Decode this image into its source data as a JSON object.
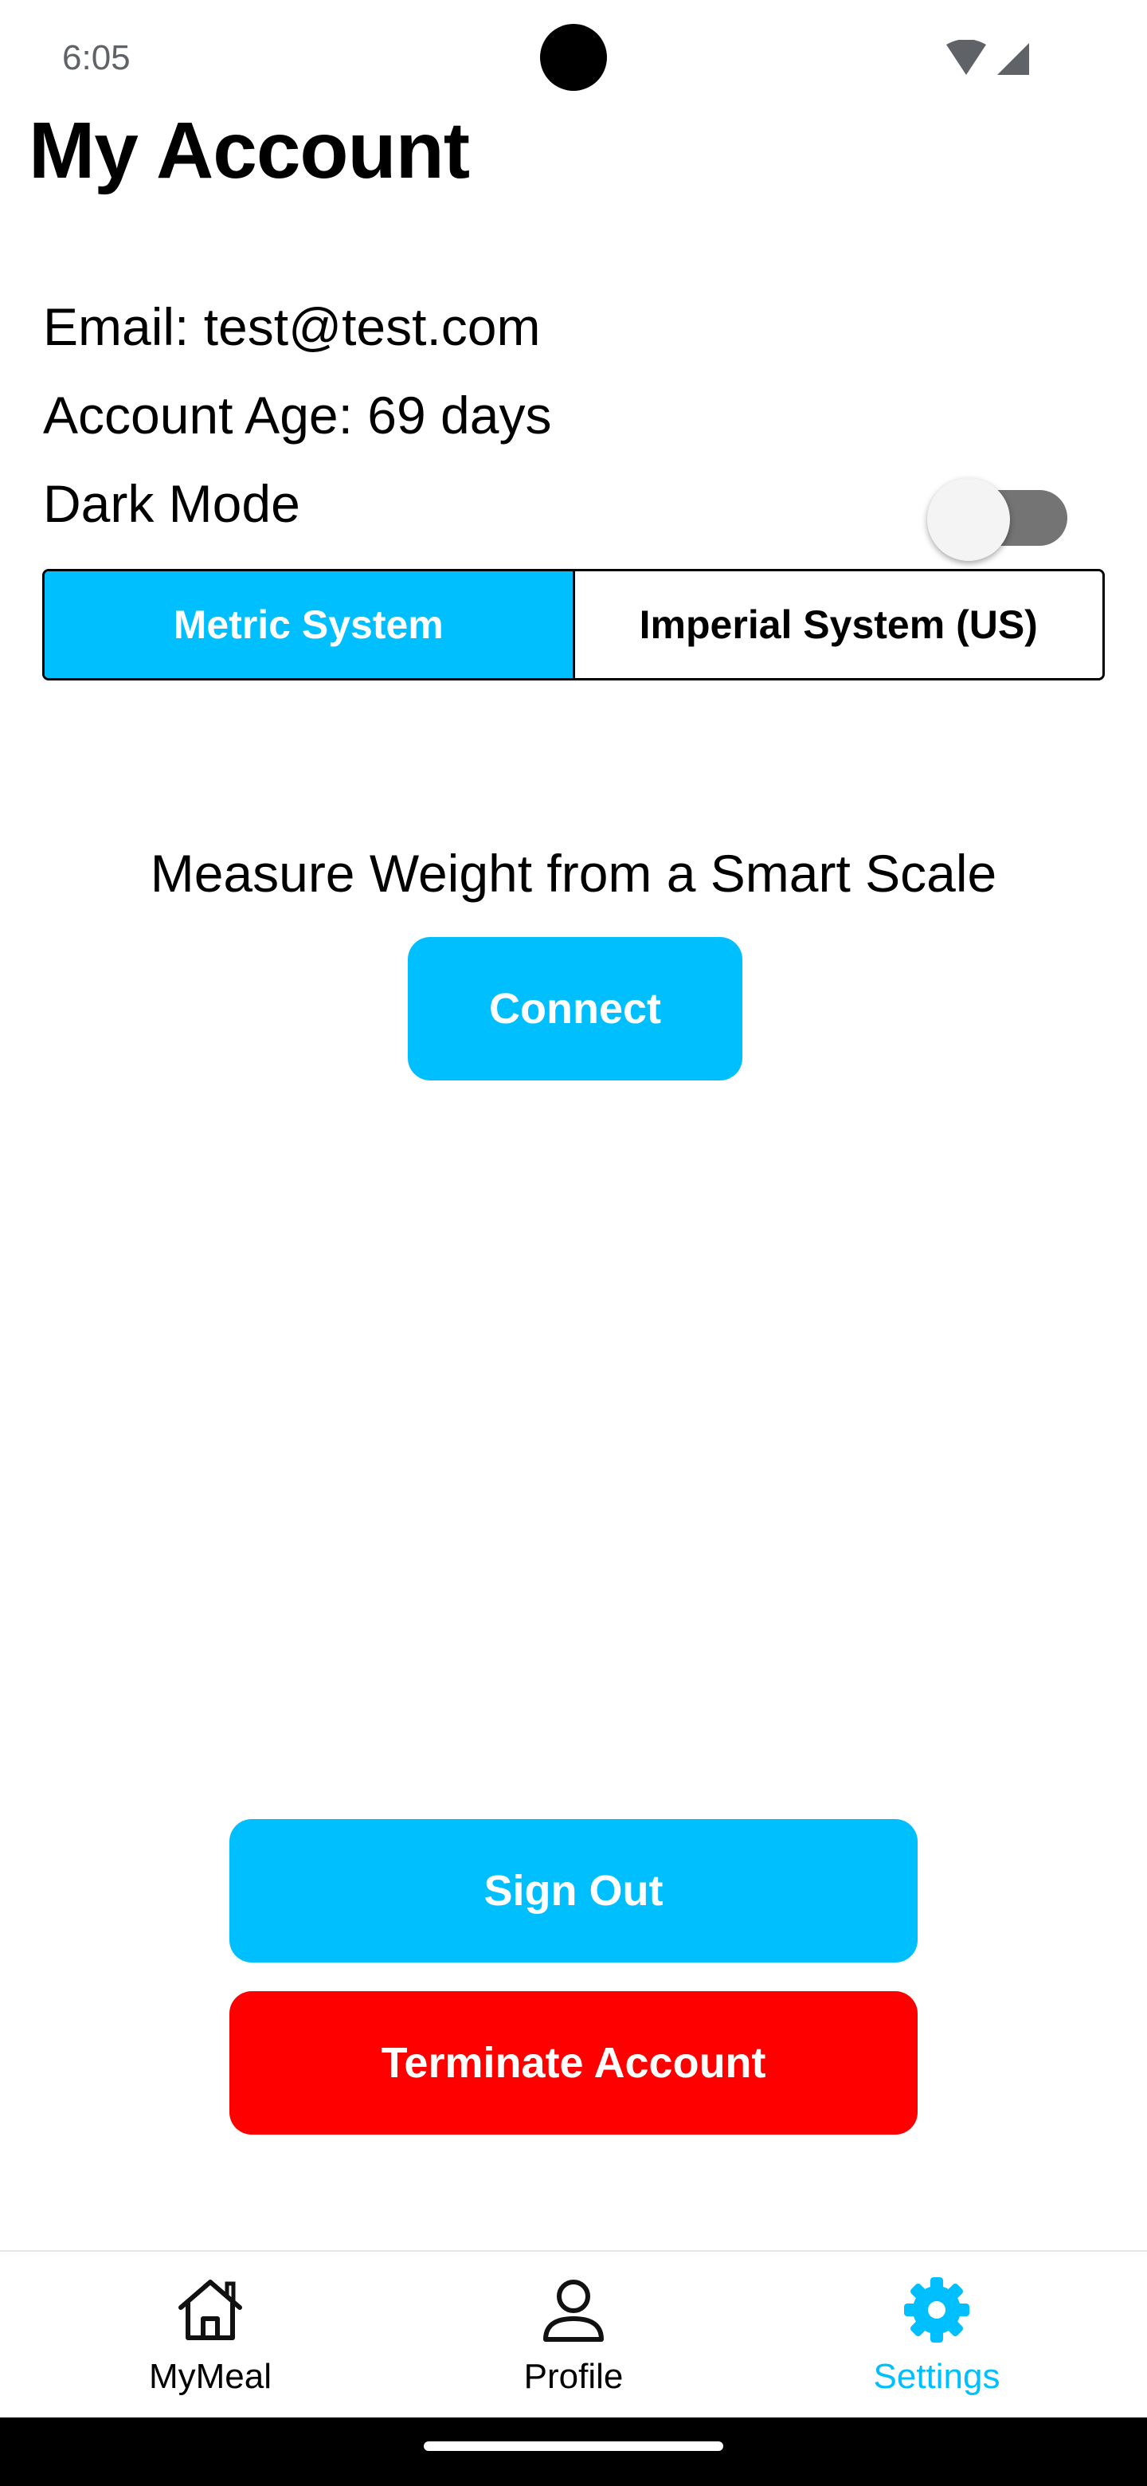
{
  "status_bar": {
    "time": "6:05",
    "icons": [
      "wifi-icon",
      "cellular-signal-icon"
    ]
  },
  "page": {
    "title": "My Account"
  },
  "account": {
    "email_line": "Email: test@test.com",
    "age_line": "Account Age: 69 days"
  },
  "dark_mode": {
    "label": "Dark Mode",
    "enabled": false
  },
  "units": {
    "options": [
      "Metric System",
      "Imperial System (US)"
    ],
    "selected": "Metric System"
  },
  "smart_scale": {
    "label": "Measure Weight from a Smart Scale",
    "connect_label": "Connect"
  },
  "actions": {
    "sign_out_label": "Sign Out",
    "terminate_label": "Terminate Account"
  },
  "bottom_nav": {
    "items": [
      {
        "label": "MyMeal",
        "icon": "home-icon",
        "active": false
      },
      {
        "label": "Profile",
        "icon": "person-icon",
        "active": false
      },
      {
        "label": "Settings",
        "icon": "gear-icon",
        "active": true
      }
    ]
  },
  "colors": {
    "accent": "#00bfff",
    "danger": "#ff0000",
    "toggle_track_off": "#747474"
  }
}
